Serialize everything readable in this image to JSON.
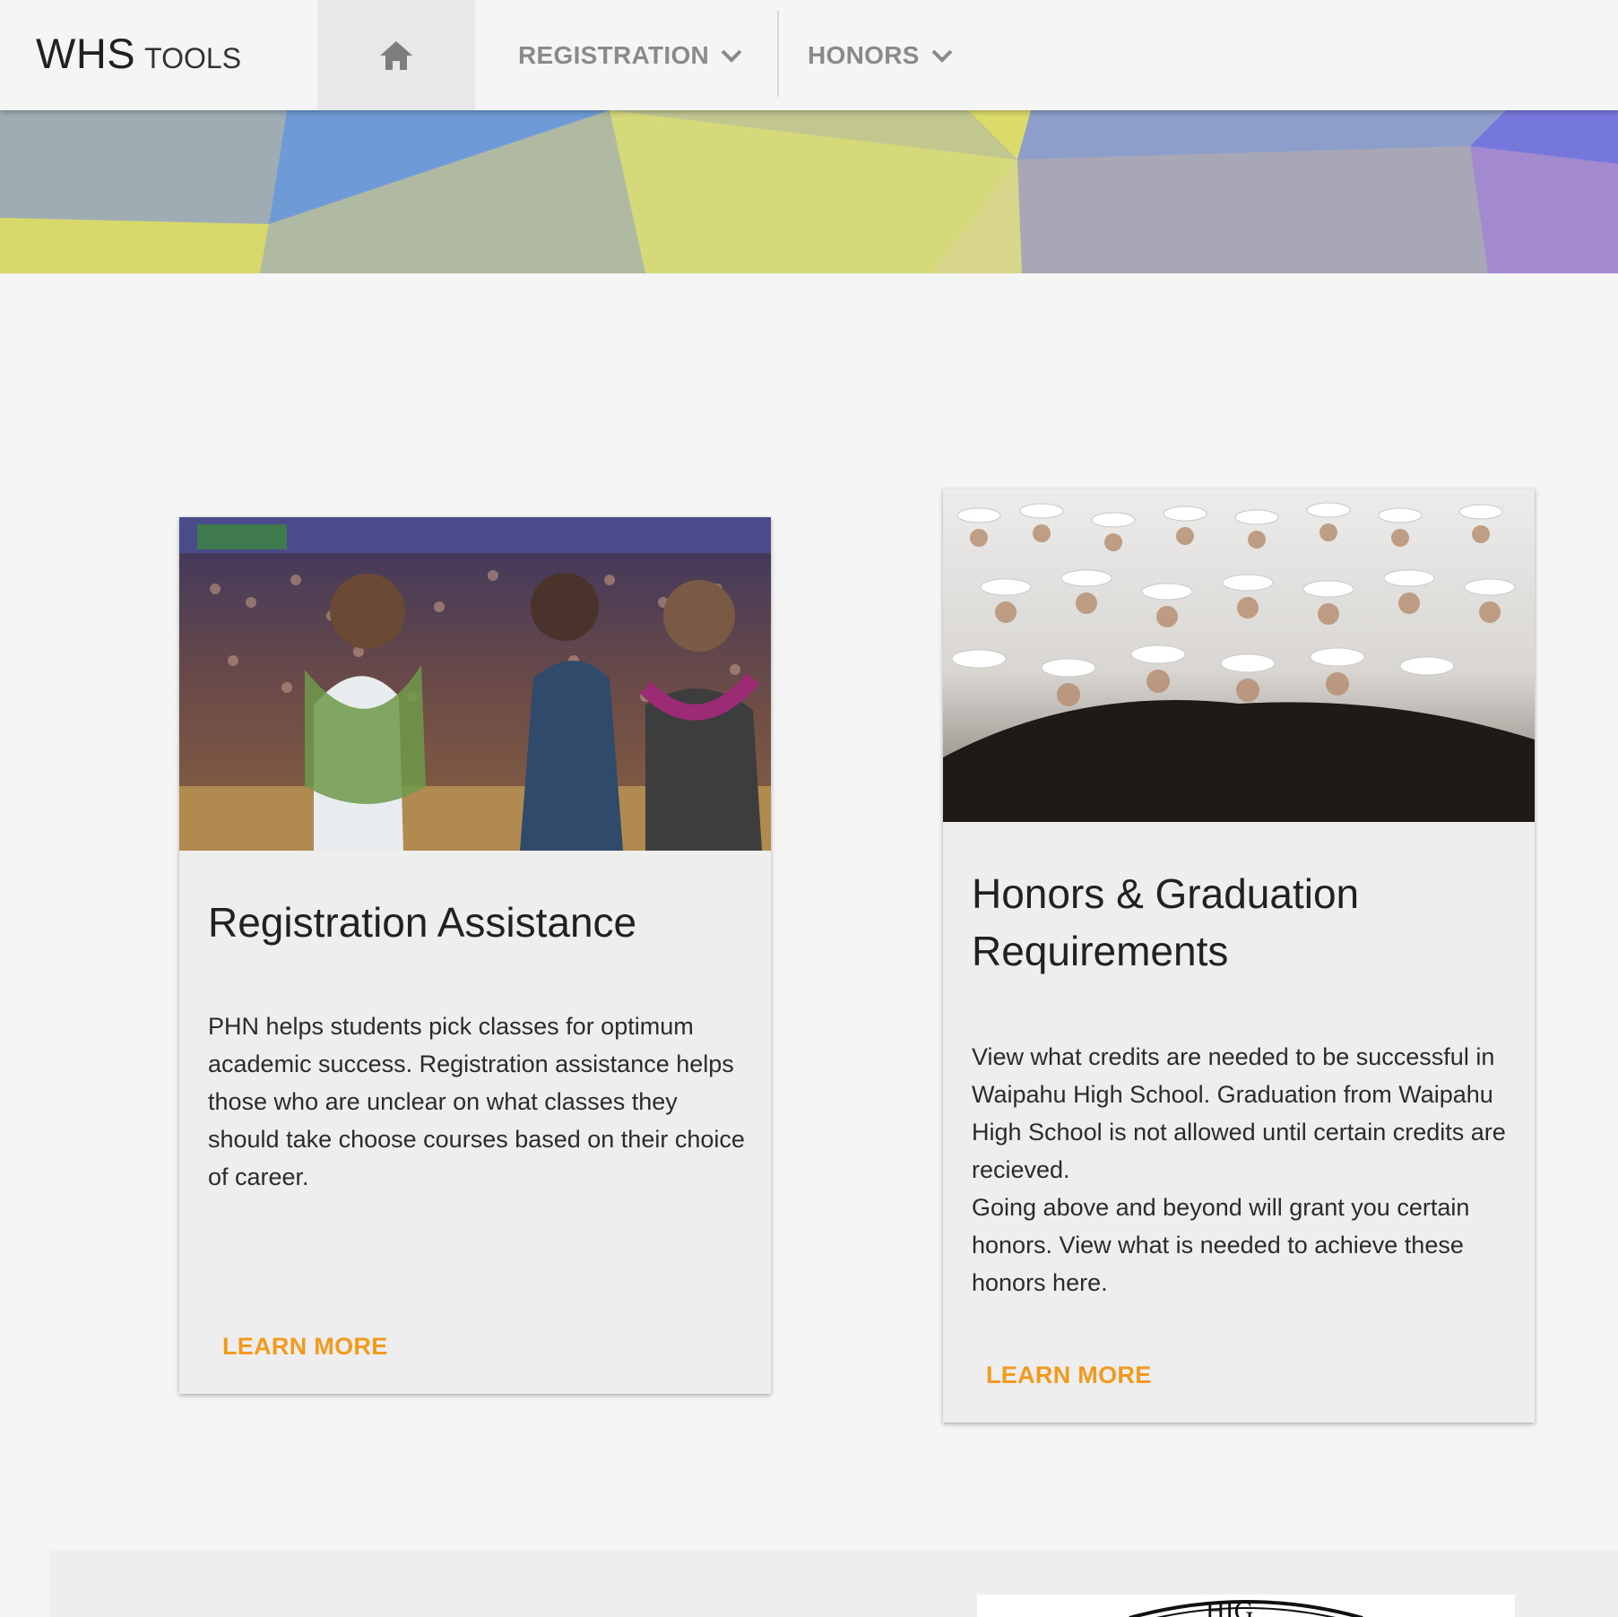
{
  "header": {
    "logo_main": "WHS",
    "logo_sub": "TOOLS",
    "home_icon": "home-icon",
    "nav": [
      {
        "label": "REGISTRATION",
        "icon": "chevron-down-icon"
      },
      {
        "label": "HONORS",
        "icon": "chevron-down-icon"
      }
    ]
  },
  "cards": [
    {
      "title": "Registration Assistance",
      "text": [
        "PHN helps students pick classes for optimum academic success. Registration assistance helps those who are unclear on what classes they should take choose courses based on their choice of career."
      ],
      "link": "LEARN MORE"
    },
    {
      "title": "Honors & Graduation Requirements",
      "text": [
        "View what credits are needed to be successful in Waipahu High School. Graduation from Waipahu High School is not allowed until certain credits are recieved.",
        "Going above and beyond will grant you certain honors. View what is needed to achieve these honors here."
      ],
      "link": "LEARN MORE"
    }
  ],
  "colors": {
    "accent": "#f29a1e",
    "nav_text": "#8a8a8a",
    "background": "#f5f5f5",
    "card": "#eeeeee"
  }
}
